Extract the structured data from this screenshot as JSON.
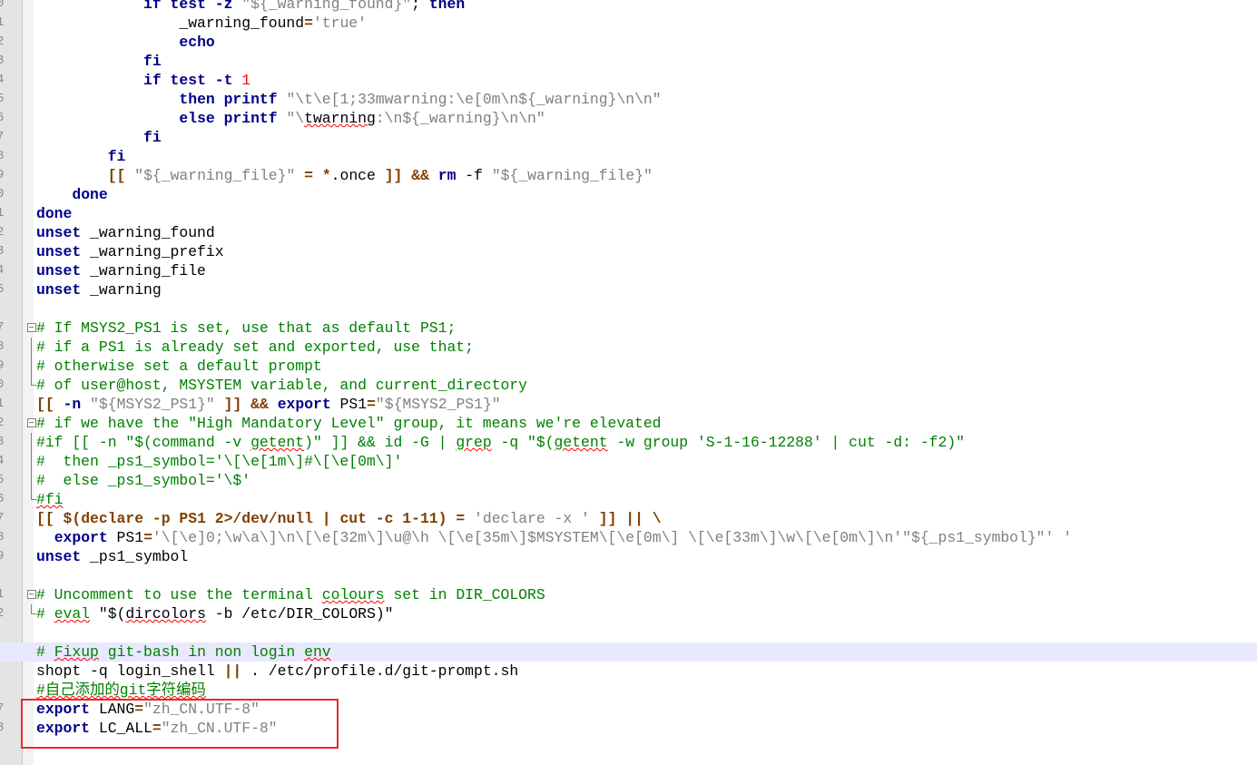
{
  "editor": {
    "lines": [
      {
        "n": "0",
        "fold": "",
        "hl": false,
        "tokens": [
          [
            "t",
            "            "
          ],
          [
            "k",
            "if test -z"
          ],
          [
            "t",
            " "
          ],
          [
            "s",
            "\"${_warning_found}\""
          ],
          [
            "t",
            "; "
          ],
          [
            "k",
            "then"
          ]
        ]
      },
      {
        "n": "1",
        "fold": "",
        "hl": false,
        "tokens": [
          [
            "t",
            "                _warning_found"
          ],
          [
            "o",
            "="
          ],
          [
            "s",
            "'true'"
          ]
        ]
      },
      {
        "n": "2",
        "fold": "",
        "hl": false,
        "tokens": [
          [
            "t",
            "                "
          ],
          [
            "k",
            "echo"
          ]
        ]
      },
      {
        "n": "3",
        "fold": "",
        "hl": false,
        "tokens": [
          [
            "t",
            "            "
          ],
          [
            "k",
            "fi"
          ]
        ]
      },
      {
        "n": "4",
        "fold": "",
        "hl": false,
        "tokens": [
          [
            "t",
            "            "
          ],
          [
            "k",
            "if test -t"
          ],
          [
            "t",
            " "
          ],
          [
            "n",
            "1"
          ]
        ]
      },
      {
        "n": "5",
        "fold": "",
        "hl": false,
        "tokens": [
          [
            "t",
            "                "
          ],
          [
            "k",
            "then printf"
          ],
          [
            "t",
            " "
          ],
          [
            "s",
            "\"\\t\\e[1;33mwarning:\\e[0m\\n${_warning}\\n\\n\""
          ]
        ]
      },
      {
        "n": "6",
        "fold": "",
        "hl": false,
        "tokens": [
          [
            "t",
            "                "
          ],
          [
            "k",
            "else printf"
          ],
          [
            "t",
            " "
          ],
          [
            "s",
            "\"\\"
          ],
          [
            "sq",
            "twarning"
          ],
          [
            "s",
            ":\\n${_warning}\\n\\n\""
          ]
        ]
      },
      {
        "n": "7",
        "fold": "",
        "hl": false,
        "tokens": [
          [
            "t",
            "            "
          ],
          [
            "k",
            "fi"
          ]
        ]
      },
      {
        "n": "8",
        "fold": "",
        "hl": false,
        "tokens": [
          [
            "t",
            "        "
          ],
          [
            "k",
            "fi"
          ]
        ]
      },
      {
        "n": "9",
        "fold": "",
        "hl": false,
        "tokens": [
          [
            "t",
            "        "
          ],
          [
            "o",
            "[["
          ],
          [
            "t",
            " "
          ],
          [
            "s",
            "\"${_warning_file}\""
          ],
          [
            "t",
            " "
          ],
          [
            "o",
            "="
          ],
          [
            "t",
            " "
          ],
          [
            "o",
            "*"
          ],
          [
            "t",
            ".once "
          ],
          [
            "o",
            "]]"
          ],
          [
            "t",
            " "
          ],
          [
            "o",
            "&&"
          ],
          [
            "t",
            " "
          ],
          [
            "k",
            "rm"
          ],
          [
            "t",
            " -f "
          ],
          [
            "s",
            "\"${_warning_file}\""
          ]
        ]
      },
      {
        "n": "0",
        "fold": "",
        "hl": false,
        "tokens": [
          [
            "t",
            "    "
          ],
          [
            "k",
            "done"
          ]
        ]
      },
      {
        "n": "1",
        "fold": "",
        "hl": false,
        "tokens": [
          [
            "k",
            "done"
          ]
        ]
      },
      {
        "n": "2",
        "fold": "",
        "hl": false,
        "tokens": [
          [
            "k",
            "unset"
          ],
          [
            "t",
            " _warning_found"
          ]
        ]
      },
      {
        "n": "3",
        "fold": "",
        "hl": false,
        "tokens": [
          [
            "k",
            "unset"
          ],
          [
            "t",
            " _warning_prefix"
          ]
        ]
      },
      {
        "n": "4",
        "fold": "",
        "hl": false,
        "tokens": [
          [
            "k",
            "unset"
          ],
          [
            "t",
            " _warning_file"
          ]
        ]
      },
      {
        "n": "5",
        "fold": "",
        "hl": false,
        "tokens": [
          [
            "k",
            "unset"
          ],
          [
            "t",
            " _warning"
          ]
        ]
      },
      {
        "n": "",
        "fold": "",
        "hl": false,
        "tokens": []
      },
      {
        "n": "7",
        "fold": "box",
        "hl": false,
        "tokens": [
          [
            "c",
            "# If MSYS2_PS1 is set, use that as default PS1;"
          ]
        ]
      },
      {
        "n": "8",
        "fold": "bar",
        "hl": false,
        "tokens": [
          [
            "c",
            "# if a PS1 is already set and exported, use that;"
          ]
        ]
      },
      {
        "n": "9",
        "fold": "bar",
        "hl": false,
        "tokens": [
          [
            "c",
            "# otherwise set a default prompt"
          ]
        ]
      },
      {
        "n": "0",
        "fold": "end",
        "hl": false,
        "tokens": [
          [
            "c",
            "# of user@host, MSYSTEM variable, and current_directory"
          ]
        ]
      },
      {
        "n": "1",
        "fold": "",
        "hl": false,
        "tokens": [
          [
            "o",
            "[["
          ],
          [
            "t",
            " "
          ],
          [
            "k",
            "-n"
          ],
          [
            "t",
            " "
          ],
          [
            "s",
            "\"${MSYS2_PS1}\""
          ],
          [
            "t",
            " "
          ],
          [
            "o",
            "]]"
          ],
          [
            "t",
            " "
          ],
          [
            "o",
            "&&"
          ],
          [
            "t",
            " "
          ],
          [
            "k",
            "export"
          ],
          [
            "t",
            " PS1"
          ],
          [
            "o",
            "="
          ],
          [
            "s",
            "\"${MSYS2_PS1}\""
          ]
        ]
      },
      {
        "n": "2",
        "fold": "box",
        "hl": false,
        "tokens": [
          [
            "c",
            "# if we have the \"High Mandatory Level\" group, it means we're elevated"
          ]
        ]
      },
      {
        "n": "3",
        "fold": "bar",
        "hl": false,
        "tokens": [
          [
            "c",
            "#if [[ -n \"$(command -v "
          ],
          [
            "c sq",
            "getent"
          ],
          [
            "c",
            ")\" ]] && id -G | "
          ],
          [
            "c sq",
            "grep"
          ],
          [
            "c",
            " -q \"$("
          ],
          [
            "c sq",
            "getent"
          ],
          [
            "c",
            " -w group 'S-1-16-12288' | cut -d: -f2)\""
          ]
        ]
      },
      {
        "n": "4",
        "fold": "bar",
        "hl": false,
        "tokens": [
          [
            "c",
            "#  then _ps1_symbol='\\[\\e[1m\\]#\\[\\e[0m\\]'"
          ]
        ]
      },
      {
        "n": "5",
        "fold": "bar",
        "hl": false,
        "tokens": [
          [
            "c",
            "#  else _ps1_symbol='\\$'"
          ]
        ]
      },
      {
        "n": "6",
        "fold": "end",
        "hl": false,
        "tokens": [
          [
            "c sq",
            "#fi"
          ]
        ]
      },
      {
        "n": "7",
        "fold": "",
        "hl": false,
        "tokens": [
          [
            "o",
            "[["
          ],
          [
            "t",
            " "
          ],
          [
            "o",
            "$(declare -p PS1 2>/dev/null | cut -c 1-11)"
          ],
          [
            "t",
            " "
          ],
          [
            "o",
            "="
          ],
          [
            "t",
            " "
          ],
          [
            "s",
            "'declare -x '"
          ],
          [
            "t",
            " "
          ],
          [
            "o",
            "]]"
          ],
          [
            "t",
            " "
          ],
          [
            "o",
            "||"
          ],
          [
            "t",
            " "
          ],
          [
            "o",
            "\\"
          ]
        ]
      },
      {
        "n": "8",
        "fold": "",
        "hl": false,
        "tokens": [
          [
            "t",
            "  "
          ],
          [
            "k",
            "export"
          ],
          [
            "t",
            " PS1"
          ],
          [
            "o",
            "="
          ],
          [
            "s",
            "'\\[\\e]0;\\w\\a\\]\\n\\[\\e[32m\\]\\u@\\h \\[\\e[35m\\]$MSYSTEM\\[\\e[0m\\] \\[\\e[33m\\]\\w\\[\\e[0m\\]\\n'\"${_ps1_symbol}\"' '"
          ]
        ]
      },
      {
        "n": "9",
        "fold": "",
        "hl": false,
        "tokens": [
          [
            "k",
            "unset"
          ],
          [
            "t",
            " _ps1_symbol"
          ]
        ]
      },
      {
        "n": "",
        "fold": "",
        "hl": false,
        "tokens": []
      },
      {
        "n": "1",
        "fold": "box",
        "hl": false,
        "tokens": [
          [
            "c",
            "# Uncomment to use the terminal "
          ],
          [
            "c sq",
            "colours"
          ],
          [
            "c",
            " set in DIR_COLORS"
          ]
        ]
      },
      {
        "n": "2",
        "fold": "end",
        "hl": false,
        "tokens": [
          [
            "c",
            "# "
          ],
          [
            "c sq",
            "eval"
          ],
          [
            "c",
            " "
          ],
          [
            "t",
            "\"$("
          ],
          [
            "t sq",
            "dircolors"
          ],
          [
            "t",
            " -b /etc/DIR_COLORS)\""
          ]
        ]
      },
      {
        "n": "",
        "fold": "",
        "hl": false,
        "tokens": []
      },
      {
        "n": "",
        "fold": "",
        "hl": true,
        "tokens": [
          [
            "c",
            "# "
          ],
          [
            "c sq",
            "Fixup"
          ],
          [
            "c",
            " git-bash in non login "
          ],
          [
            "c sq",
            "env"
          ]
        ]
      },
      {
        "n": "",
        "fold": "",
        "hl": false,
        "tokens": [
          [
            "t",
            "shopt -q login_shell "
          ],
          [
            "o",
            "||"
          ],
          [
            "t",
            " . /etc/profile.d/git-prompt.sh"
          ]
        ]
      },
      {
        "n": "",
        "fold": "",
        "hl": false,
        "tokens": [
          [
            "c sq",
            "#自己添加的git字符编码"
          ]
        ]
      },
      {
        "n": "7",
        "fold": "",
        "hl": false,
        "tokens": [
          [
            "k",
            "export"
          ],
          [
            "t",
            " LANG"
          ],
          [
            "o",
            "="
          ],
          [
            "s",
            "\"zh_CN.UTF-8\""
          ]
        ]
      },
      {
        "n": "8",
        "fold": "",
        "hl": false,
        "tokens": [
          [
            "k",
            "export"
          ],
          [
            "t",
            " LC_ALL"
          ],
          [
            "o",
            "="
          ],
          [
            "s",
            "\"zh_CN.UTF-8\""
          ]
        ]
      }
    ]
  }
}
